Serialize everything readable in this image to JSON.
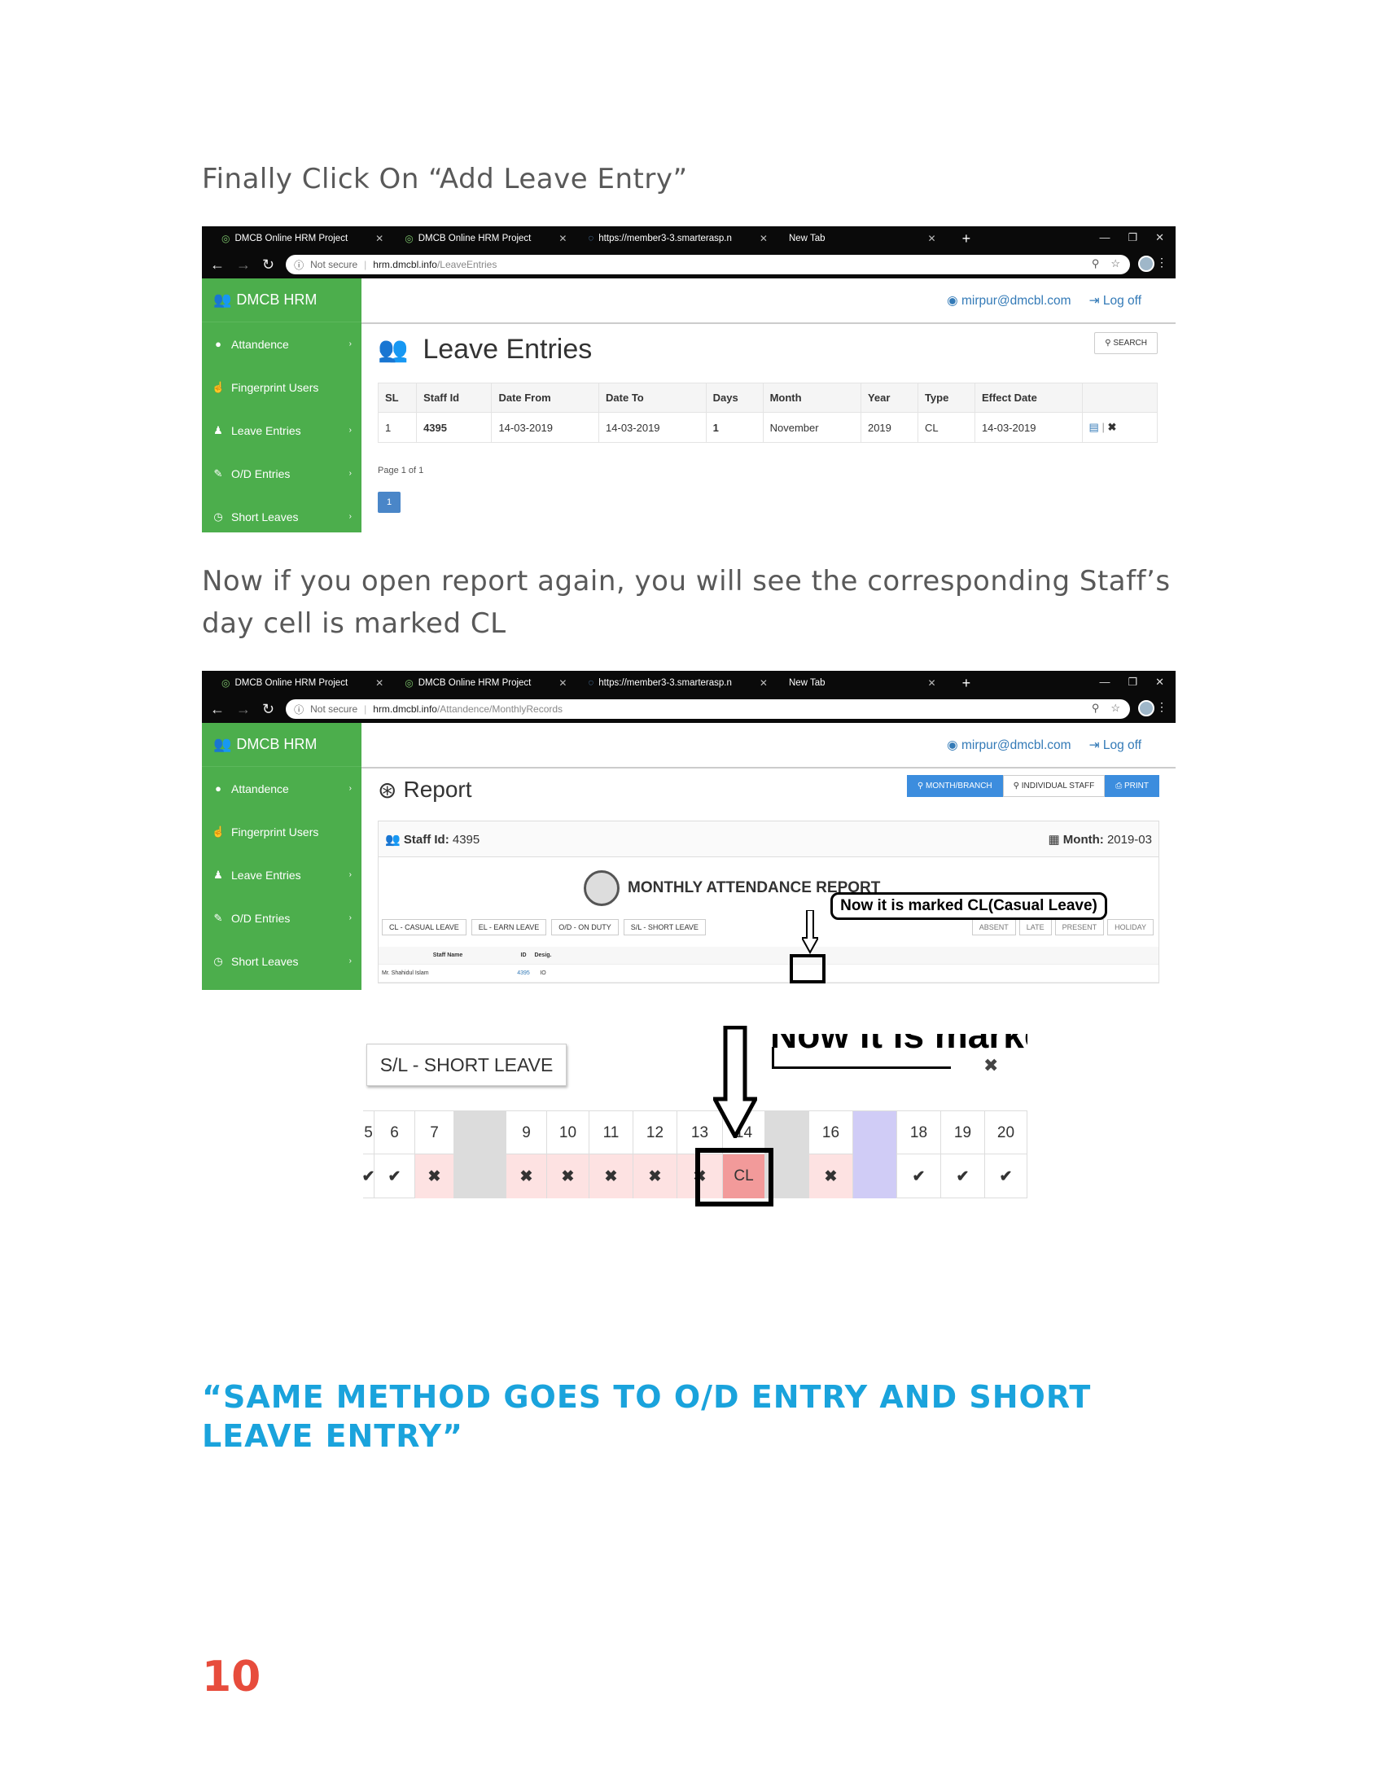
{
  "instructions": {
    "step1": "Finally Click On “Add Leave Entry”",
    "step2": "Now if you open report again, you will see the corresponding Staff’s day cell is marked CL"
  },
  "browser": {
    "tabs": [
      "DMCB Online HRM Project",
      "DMCB Online HRM Project",
      "https://member3-3.smarterasp.n",
      "New Tab"
    ],
    "not_secure": "Not secure",
    "url_host": "hrm.dmcbl.info",
    "url_path_1": "/LeaveEntries",
    "url_path_2": "/Attandence/MonthlyRecords"
  },
  "app": {
    "brand": "DMCB HRM",
    "user_email": "mirpur@dmcbl.com",
    "logoff": "Log off",
    "sidebar": [
      "Attandence",
      "Fingerprint Users",
      "Leave Entries",
      "O/D Entries",
      "Short Leaves"
    ]
  },
  "leave_entries": {
    "title": "Leave Entries",
    "search": "SEARCH",
    "headers": [
      "SL",
      "Staff Id",
      "Date From",
      "Date To",
      "Days",
      "Month",
      "Year",
      "Type",
      "Effect Date"
    ],
    "row": [
      "1",
      "4395",
      "14-03-2019",
      "14-03-2019",
      "1",
      "November",
      "2019",
      "CL",
      "14-03-2019"
    ],
    "page_info": "Page 1 of 1",
    "page_num": "1"
  },
  "report": {
    "title": "Report",
    "btn_month": "MONTH/BRANCH",
    "btn_individual": "INDIVIDUAL STAFF",
    "btn_print": "PRINT",
    "staff_label": "Staff Id:",
    "staff_id": "4395",
    "month_label": "Month:",
    "month": "2019-03",
    "heading": "MONTHLY ATTENDANCE REPORT",
    "legend": [
      "CL - CASUAL LEAVE",
      "EL - EARN LEAVE",
      "O/D - ON DUTY",
      "S/L - SHORT LEAVE"
    ],
    "legend_right": [
      "ABSENT",
      "LATE",
      "PRESENT",
      "HOLIDAY"
    ],
    "col_staff_name": "Staff Name",
    "col_id": "ID",
    "col_desig": "Desig.",
    "staff_name": "Mr. Shahidul Islam",
    "staff_row_id": "4395",
    "staff_desig": "IO"
  },
  "callout": "Now it is marked CL(Casual Leave)",
  "zoom": {
    "short_leave": "S/L - SHORT LEAVE",
    "fragment": "Now it is marke",
    "days": [
      "5",
      "6",
      "7",
      "",
      "9",
      "10",
      "11",
      "12",
      "13",
      "14",
      "",
      "16",
      "",
      "18",
      "19",
      "20"
    ],
    "cl": "CL"
  },
  "tagline": "“SAME METHOD GOES TO O/D ENTRY AND SHORT LEAVE ENTRY”",
  "page_number": "10",
  "colors": {
    "sidebar": "#4cae4c",
    "accent": "#1aa3dc",
    "page_number": "#e74c3c",
    "link": "#337ab7"
  }
}
